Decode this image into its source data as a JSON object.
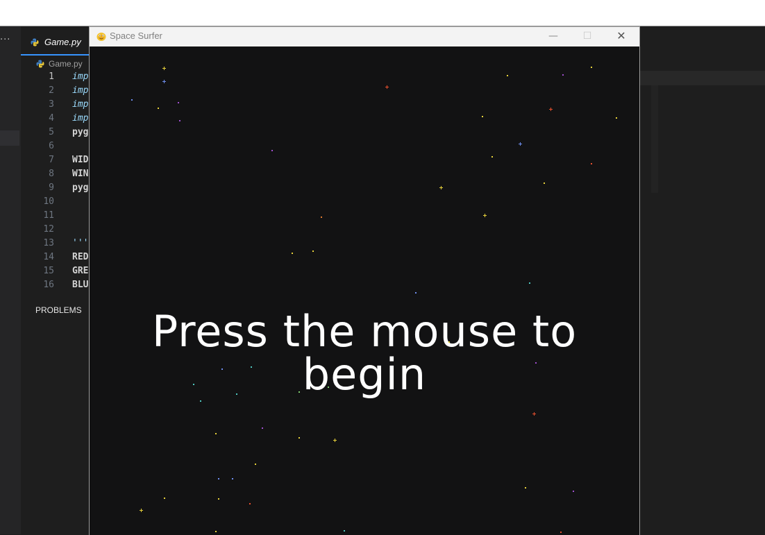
{
  "editor": {
    "tab_label": "Game.py",
    "breadcrumb": "Game.py",
    "panel_label": "PROBLEMS",
    "code_lines": [
      {
        "n": "1",
        "text": "imp",
        "kw": true
      },
      {
        "n": "2",
        "text": "imp",
        "kw": true
      },
      {
        "n": "3",
        "text": "imp",
        "kw": true
      },
      {
        "n": "4",
        "text": "imp",
        "kw": true
      },
      {
        "n": "5",
        "text": "pyg",
        "kw": false
      },
      {
        "n": "6",
        "text": "",
        "kw": false
      },
      {
        "n": "7",
        "text": "WID",
        "kw": false
      },
      {
        "n": "8",
        "text": "WIN",
        "kw": false
      },
      {
        "n": "9",
        "text": "pyg",
        "kw": false
      },
      {
        "n": "10",
        "text": "",
        "kw": false
      },
      {
        "n": "11",
        "text": "",
        "kw": false
      },
      {
        "n": "12",
        "text": "",
        "kw": false
      },
      {
        "n": "13",
        "text": "'''",
        "kw": true
      },
      {
        "n": "14",
        "text": "RED",
        "kw": false
      },
      {
        "n": "15",
        "text": "GRE",
        "kw": false
      },
      {
        "n": "16",
        "text": "BLU",
        "kw": false
      }
    ]
  },
  "game_window": {
    "title": "Space Surfer",
    "minimize_glyph": "—",
    "maximize_glyph": "☐",
    "close_glyph": "✕",
    "prompt": "Press  the mouse to begin",
    "colors": {
      "background": "#121213",
      "yellow": "#e8d23a",
      "red": "#e8502e",
      "blue": "#6f8ff0",
      "purple": "#a04fd0",
      "green": "#7fd06f",
      "cyan": "#4fc8c0",
      "orange": "#e07a2e"
    }
  }
}
